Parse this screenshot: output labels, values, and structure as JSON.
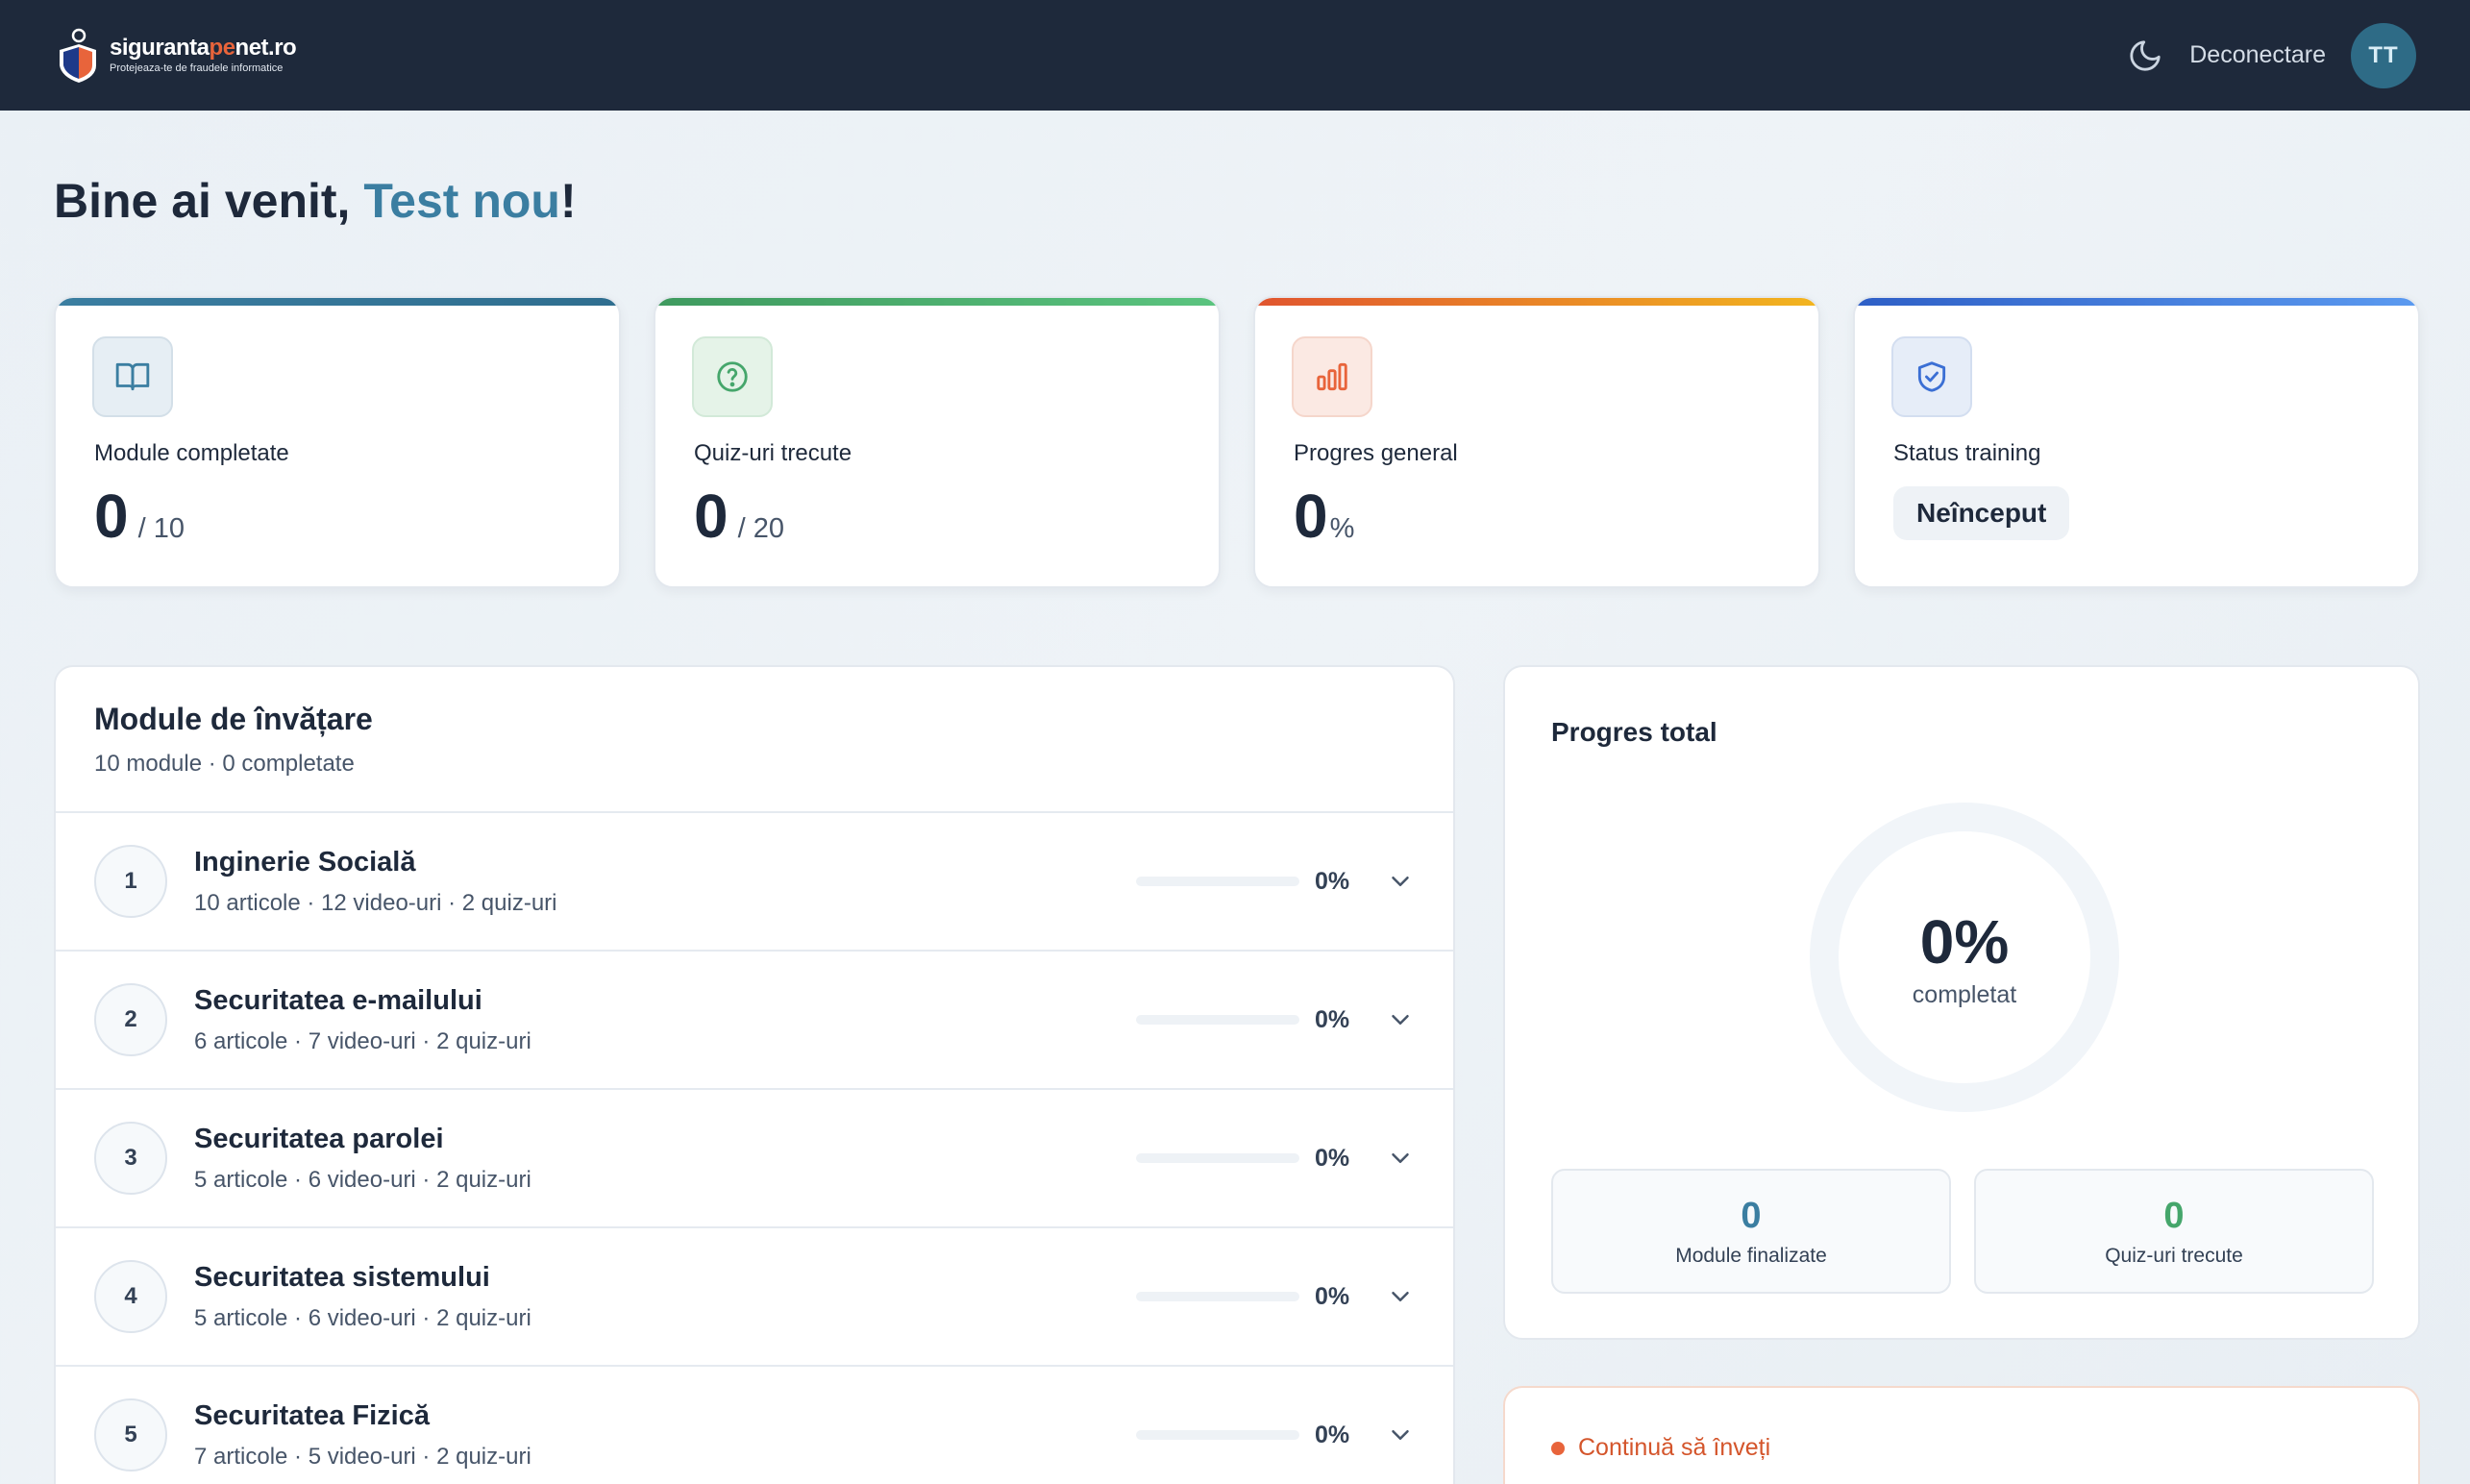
{
  "header": {
    "brand_prefix": "siguranta",
    "brand_accent": "pe",
    "brand_suffix": "net.ro",
    "brand_tagline": "Protejeaza-te de fraudele informatice",
    "logout_label": "Deconectare",
    "avatar_initials": "TT"
  },
  "welcome": {
    "greeting": "Bine ai venit, ",
    "user_name": "Test nou",
    "suffix": "!"
  },
  "stats": {
    "modules": {
      "label": "Module completate",
      "value": "0",
      "total": "/ 10",
      "accent": "#3b7ea1"
    },
    "quizzes": {
      "label": "Quiz-uri trecute",
      "value": "0",
      "total": "/ 20",
      "accent": "#45a66b"
    },
    "progress": {
      "label": "Progres general",
      "value": "0",
      "unit": "%",
      "accent": "#e8643b"
    },
    "status": {
      "label": "Status training",
      "value": "Neînceput",
      "accent": "#3b6fd4"
    }
  },
  "modules_panel": {
    "title": "Module de învățare",
    "subtitle": "10 module · 0 completate",
    "items": [
      {
        "num": "1",
        "title": "Inginerie Socială",
        "meta": "10 articole · 12 video-uri · 2 quiz-uri",
        "progress": "0%",
        "progress_value": 0
      },
      {
        "num": "2",
        "title": "Securitatea e-mailului",
        "meta": "6 articole · 7 video-uri · 2 quiz-uri",
        "progress": "0%",
        "progress_value": 0
      },
      {
        "num": "3",
        "title": "Securitatea parolei",
        "meta": "5 articole · 6 video-uri · 2 quiz-uri",
        "progress": "0%",
        "progress_value": 0
      },
      {
        "num": "4",
        "title": "Securitatea sistemului",
        "meta": "5 articole · 6 video-uri · 2 quiz-uri",
        "progress": "0%",
        "progress_value": 0
      },
      {
        "num": "5",
        "title": "Securitatea Fizică",
        "meta": "7 articole · 5 video-uri · 2 quiz-uri",
        "progress": "0%",
        "progress_value": 0
      }
    ]
  },
  "progress_total": {
    "title": "Progres total",
    "percent": "0%",
    "percent_value": 0,
    "label": "completat",
    "modules_done": {
      "value": "0",
      "label": "Module finalizate",
      "color": "#3b7ea1"
    },
    "quizzes_passed": {
      "value": "0",
      "label": "Quiz-uri trecute",
      "color": "#45a66b"
    }
  },
  "continue_card": {
    "label": "Continuă să înveți"
  }
}
